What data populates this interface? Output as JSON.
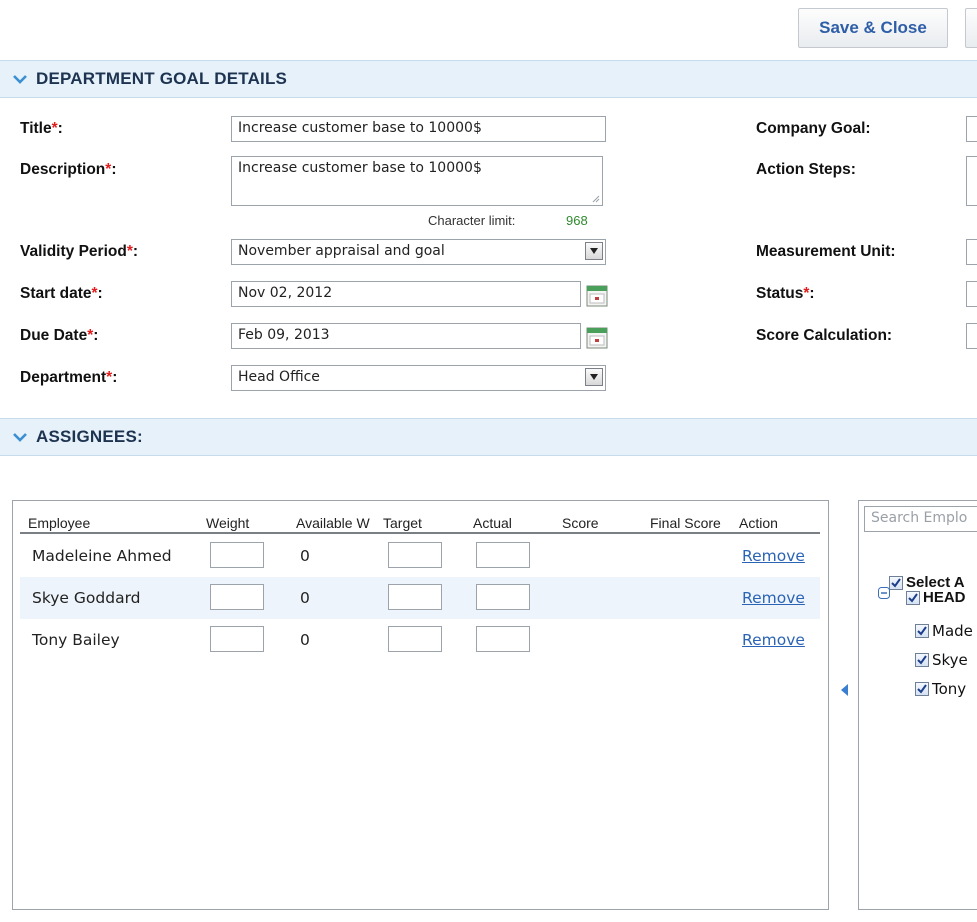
{
  "toolbar": {
    "save_close_label": "Save & Close"
  },
  "sections": {
    "goal_details": "DEPARTMENT GOAL DETAILS",
    "assignees": "ASSIGNEES:"
  },
  "form": {
    "title": {
      "label": "Title",
      "suffix": ":",
      "value": "Increase customer base to 10000$"
    },
    "description": {
      "label": "Description",
      "suffix": ":",
      "value": "Increase customer base to 10000$"
    },
    "char_limit": {
      "label": "Character limit:",
      "value": "968"
    },
    "validity_period": {
      "label": "Validity Period",
      "suffix": ":",
      "value": "November appraisal and goal"
    },
    "start_date": {
      "label": "Start date",
      "suffix": ":",
      "value": "Nov 02, 2012"
    },
    "due_date": {
      "label": "Due Date",
      "suffix": ":",
      "value": "Feb 09, 2013"
    },
    "department": {
      "label": "Department",
      "suffix": ":",
      "value": "Head Office"
    },
    "required_mark": "*"
  },
  "right_form": {
    "company_goal": "Company Goal:",
    "action_steps": "Action Steps:",
    "measurement_unit": "Measurement Unit:",
    "status": {
      "label": "Status",
      "suffix": ":"
    },
    "score_calculation": "Score Calculation:"
  },
  "assignees_table": {
    "columns": [
      "Employee",
      "Weight",
      "Available W",
      "Target",
      "Actual",
      "Score",
      "Final Score",
      "Action"
    ],
    "rows": [
      {
        "employee": "Madeleine Ahmed",
        "available": "0",
        "action": "Remove"
      },
      {
        "employee": "Skye Goddard",
        "available": "0",
        "action": "Remove"
      },
      {
        "employee": "Tony Bailey",
        "available": "0",
        "action": "Remove"
      }
    ]
  },
  "employee_picker": {
    "search_placeholder": "Search Emplo",
    "select_all": "Select A",
    "group": "HEAD",
    "members": [
      "Made",
      "Skye",
      "Tony"
    ]
  },
  "colors": {
    "section_bg": "#e6f1fa",
    "link": "#2b64b5",
    "required": "#e21d1d",
    "char_count": "#2f8a2f"
  }
}
